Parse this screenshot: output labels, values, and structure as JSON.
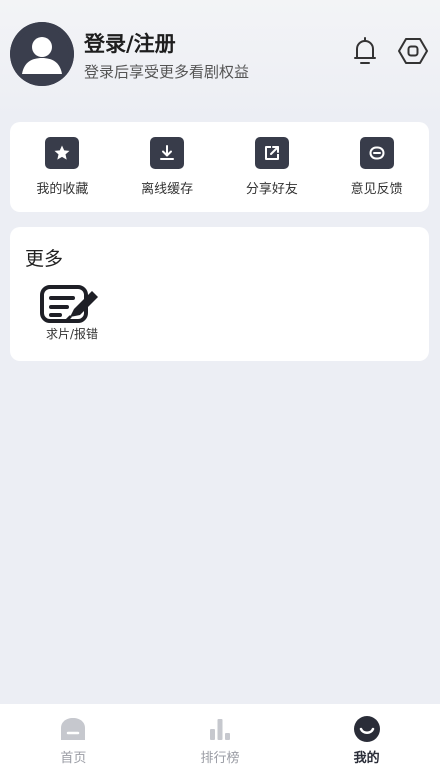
{
  "profile": {
    "title": "登录/注册",
    "subtitle": "登录后享受更多看剧权益"
  },
  "header_icons": [
    "bell-icon",
    "settings-icon"
  ],
  "actions": [
    {
      "label": "我的收藏",
      "icon": "star-icon"
    },
    {
      "label": "离线缓存",
      "icon": "download-icon"
    },
    {
      "label": "分享好友",
      "icon": "share-icon"
    },
    {
      "label": "意见反馈",
      "icon": "message-icon"
    }
  ],
  "more": {
    "title": "更多",
    "items": [
      {
        "label": "求片/报错",
        "icon": "edit-document-icon"
      }
    ]
  },
  "bottom_nav": {
    "items": [
      {
        "label": "首页",
        "icon": "home-icon",
        "active": false
      },
      {
        "label": "排行榜",
        "icon": "bar-chart-icon",
        "active": false
      },
      {
        "label": "我的",
        "icon": "profile-face-icon",
        "active": true
      }
    ]
  },
  "colors": {
    "icon_dark": "#383c4a",
    "nav_inactive": "#c6c8ce",
    "background": "#eceef4"
  }
}
